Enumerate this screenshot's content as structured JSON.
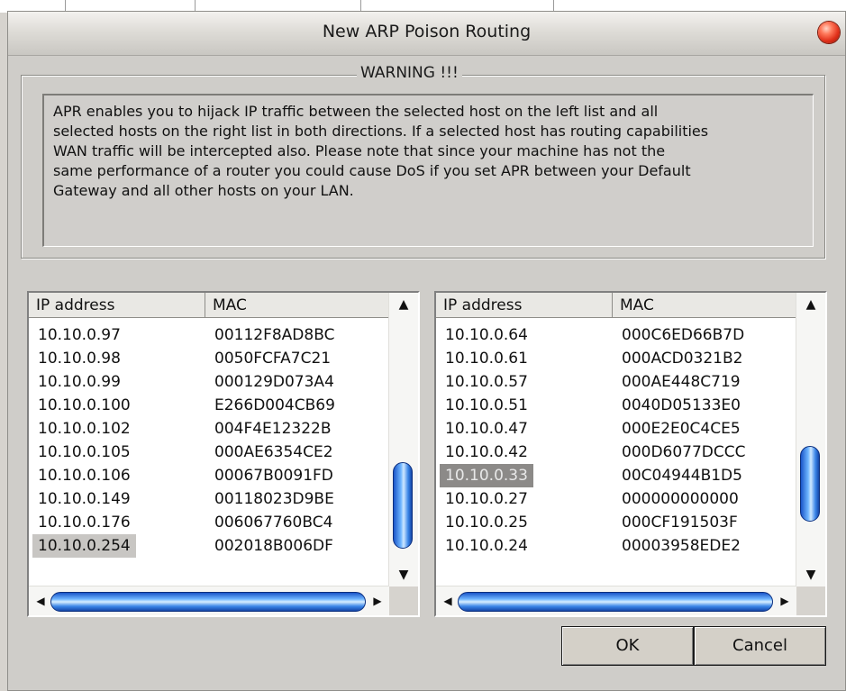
{
  "window": {
    "title": "New ARP Poison Routing"
  },
  "warning": {
    "legend": "WARNING !!!",
    "lines": [
      "APR enables you to hijack IP traffic between the selected host on the left list and all",
      "selected hosts on the right list in both directions. If a selected host has routing capabilities",
      "WAN traffic will be intercepted also. Please note that since your machine has not the",
      "same performance of a router you could cause DoS if you set APR between your Default",
      "Gateway and all other hosts on your LAN."
    ]
  },
  "left_list": {
    "columns": [
      "IP address",
      "MAC"
    ],
    "rows": [
      {
        "ip": "10.10.0.97",
        "mac": "00112F8AD8BC"
      },
      {
        "ip": "10.10.0.98",
        "mac": "0050FCFA7C21"
      },
      {
        "ip": "10.10.0.99",
        "mac": "000129D073A4"
      },
      {
        "ip": "10.10.0.100",
        "mac": "E266D004CB69"
      },
      {
        "ip": "10.10.0.102",
        "mac": "004F4E12322B"
      },
      {
        "ip": "10.10.0.105",
        "mac": "000AE6354CE2"
      },
      {
        "ip": "10.10.0.106",
        "mac": "00067B0091FD"
      },
      {
        "ip": "10.10.0.149",
        "mac": "00118023D9BE"
      },
      {
        "ip": "10.10.0.176",
        "mac": "006067760BC4"
      },
      {
        "ip": "10.10.0.254",
        "mac": "002018B006DF",
        "selected": true
      }
    ]
  },
  "right_list": {
    "columns": [
      "IP address",
      "MAC"
    ],
    "rows": [
      {
        "ip": "10.10.0.64",
        "mac": "000C6ED66B7D"
      },
      {
        "ip": "10.10.0.61",
        "mac": "000ACD0321B2"
      },
      {
        "ip": "10.10.0.57",
        "mac": "000AE448C719"
      },
      {
        "ip": "10.10.0.51",
        "mac": "0040D05133E0"
      },
      {
        "ip": "10.10.0.47",
        "mac": "000E2E0C4CE5"
      },
      {
        "ip": "10.10.0.42",
        "mac": "000D6077DCCC"
      },
      {
        "ip": "10.10.0.33",
        "mac": "00C04944B1D5",
        "selected": true
      },
      {
        "ip": "10.10.0.27",
        "mac": "000000000000"
      },
      {
        "ip": "10.10.0.25",
        "mac": "000CF191503F"
      },
      {
        "ip": "10.10.0.24",
        "mac": "00003958EDE2"
      }
    ]
  },
  "buttons": {
    "ok": "OK",
    "cancel": "Cancel"
  },
  "icons": {
    "close": "close-icon",
    "scroll_up": "arrow-up-icon",
    "scroll_down": "arrow-down-icon",
    "scroll_left": "arrow-left-icon",
    "scroll_right": "arrow-right-icon"
  },
  "colors": {
    "scroll_thumb": "#3b86e8",
    "close_button": "#e0301a",
    "selected_row": "#c8c6c3"
  }
}
